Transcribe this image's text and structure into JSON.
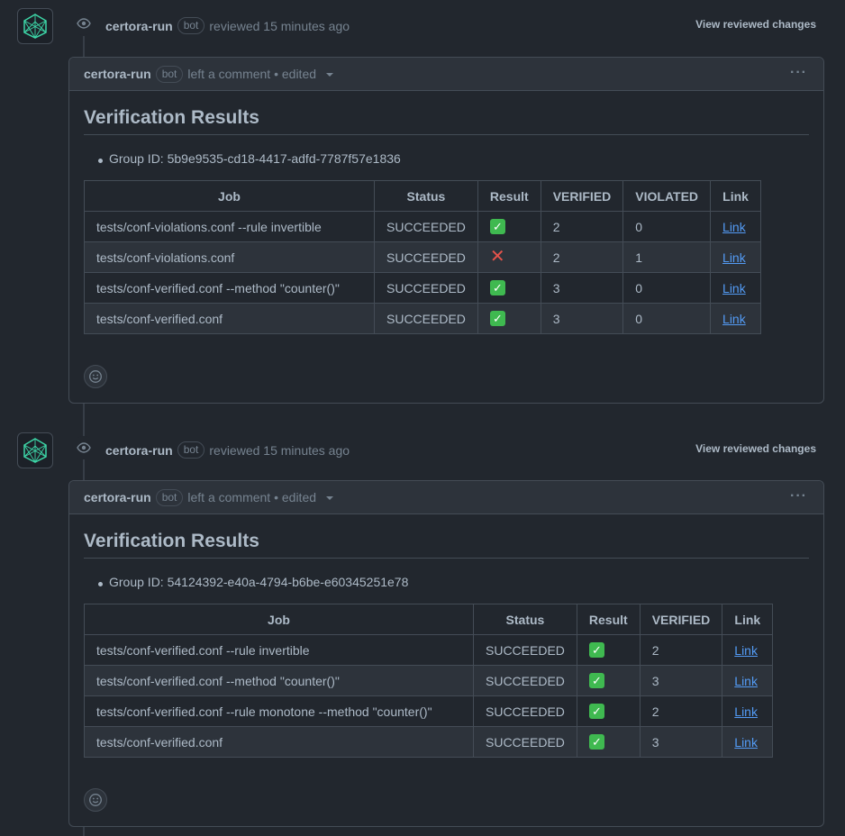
{
  "reviews": [
    {
      "author": "certora-run",
      "bot_badge": "bot",
      "action": "reviewed 15 minutes ago",
      "view_changes": "View reviewed changes",
      "comment": {
        "author": "certora-run",
        "bot_badge": "bot",
        "meta": "left a comment • edited",
        "title": "Verification Results",
        "group_id": "Group ID: 5b9e9535-cd18-4417-adfd-7787f57e1836",
        "columns": [
          "Job",
          "Status",
          "Result",
          "VERIFIED",
          "VIOLATED",
          "Link"
        ],
        "rows": [
          {
            "job": "tests/conf-violations.conf --rule invertible",
            "status": "SUCCEEDED",
            "result": "pass",
            "verified": "2",
            "violated": "0",
            "link": "Link"
          },
          {
            "job": "tests/conf-violations.conf",
            "status": "SUCCEEDED",
            "result": "fail",
            "verified": "2",
            "violated": "1",
            "link": "Link"
          },
          {
            "job": "tests/conf-verified.conf --method \"counter()\"",
            "status": "SUCCEEDED",
            "result": "pass",
            "verified": "3",
            "violated": "0",
            "link": "Link"
          },
          {
            "job": "tests/conf-verified.conf",
            "status": "SUCCEEDED",
            "result": "pass",
            "verified": "3",
            "violated": "0",
            "link": "Link"
          }
        ]
      }
    },
    {
      "author": "certora-run",
      "bot_badge": "bot",
      "action": "reviewed 15 minutes ago",
      "view_changes": "View reviewed changes",
      "comment": {
        "author": "certora-run",
        "bot_badge": "bot",
        "meta": "left a comment • edited",
        "title": "Verification Results",
        "group_id": "Group ID: 54124392-e40a-4794-b6be-e60345251e78",
        "columns": [
          "Job",
          "Status",
          "Result",
          "VERIFIED",
          "Link"
        ],
        "rows": [
          {
            "job": "tests/conf-verified.conf --rule invertible",
            "status": "SUCCEEDED",
            "result": "pass",
            "verified": "2",
            "link": "Link"
          },
          {
            "job": "tests/conf-verified.conf --method \"counter()\"",
            "status": "SUCCEEDED",
            "result": "pass",
            "verified": "3",
            "link": "Link"
          },
          {
            "job": "tests/conf-verified.conf --rule monotone --method \"counter()\"",
            "status": "SUCCEEDED",
            "result": "pass",
            "verified": "2",
            "link": "Link"
          },
          {
            "job": "tests/conf-verified.conf",
            "status": "SUCCEEDED",
            "result": "pass",
            "verified": "3",
            "link": "Link"
          }
        ]
      }
    }
  ],
  "icons": {
    "eye": "eye-icon",
    "kebab": "kebab-horizontal-icon",
    "smiley": "smiley-icon",
    "pass": "white-check-mark",
    "fail": "cross-mark"
  },
  "colors": {
    "background": "#22272e",
    "header": "#2d333b",
    "border": "#444c56",
    "link": "#539bf5",
    "pass": "#3fb950",
    "fail": "#e5534b"
  }
}
